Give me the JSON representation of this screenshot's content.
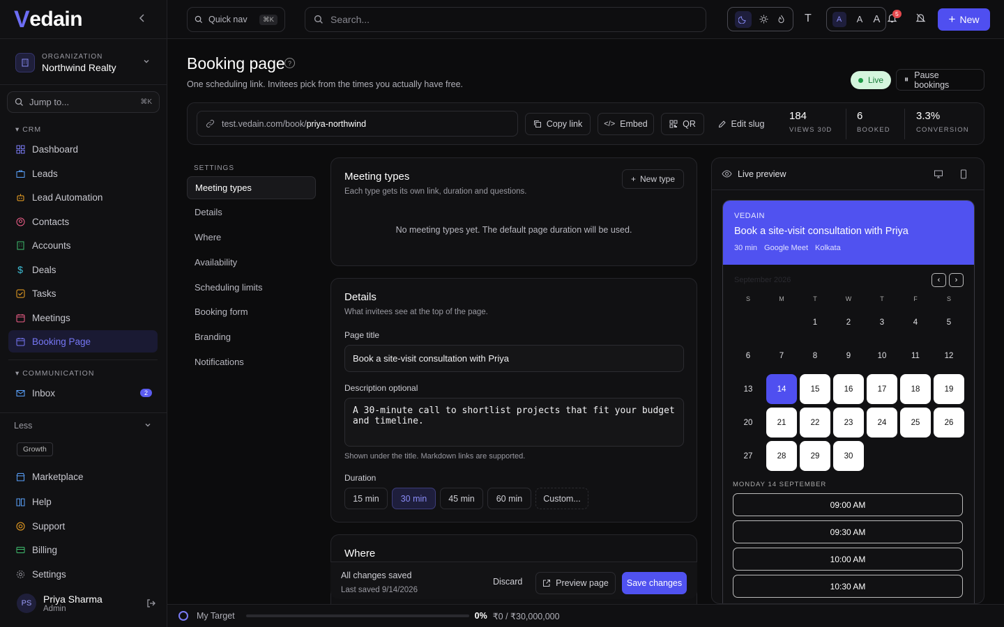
{
  "brand": {
    "logo_v": "V",
    "logo_rest": "edain"
  },
  "org": {
    "caption": "ORGANIZATION",
    "name": "Northwind Realty"
  },
  "jump": {
    "placeholder": "Jump to...",
    "shortcut": "⌘K"
  },
  "sidebar": {
    "crm_label": "CRM",
    "crm_items": [
      {
        "label": "Dashboard",
        "icon": "grid-icon"
      },
      {
        "label": "Leads",
        "icon": "briefcase-icon"
      },
      {
        "label": "Lead Automation",
        "icon": "robot-icon"
      },
      {
        "label": "Contacts",
        "icon": "contact-icon"
      },
      {
        "label": "Accounts",
        "icon": "building-icon"
      },
      {
        "label": "Deals",
        "icon": "dollar-icon"
      },
      {
        "label": "Tasks",
        "icon": "checkbox-icon"
      },
      {
        "label": "Meetings",
        "icon": "calendar-icon"
      },
      {
        "label": "Booking Page",
        "icon": "calendar-check-icon",
        "active": true
      }
    ],
    "comm_label": "COMMUNICATION",
    "inbox": {
      "label": "Inbox",
      "count": "2"
    },
    "less_label": "Less",
    "growth_tag": "Growth",
    "bottom_items": [
      {
        "label": "Marketplace",
        "icon": "store-icon"
      },
      {
        "label": "Help",
        "icon": "book-icon"
      },
      {
        "label": "Support",
        "icon": "lifebuoy-icon"
      },
      {
        "label": "Billing",
        "icon": "card-icon"
      },
      {
        "label": "Settings",
        "icon": "gear-icon"
      }
    ],
    "user": {
      "initials": "PS",
      "name": "Priya Sharma",
      "role": "Admin"
    }
  },
  "topbar": {
    "quicknav": "Quick nav",
    "quicknav_kbd": "⌘K",
    "search_placeholder": "Search...",
    "font_label": "T",
    "size_a": "A",
    "notif_count": "5",
    "new_label": "New"
  },
  "page": {
    "title": "Booking page",
    "subtitle": "One scheduling link. Invitees pick from the times you actually have free.",
    "live_label": "Live",
    "pause_label": "Pause bookings"
  },
  "link": {
    "url_prefix": "test.vedain.com/book/",
    "slug": "priya-northwind",
    "copy": "Copy link",
    "embed": "Embed",
    "qr": "QR",
    "edit_slug": "Edit slug"
  },
  "stats": [
    {
      "value": "184",
      "label": "VIEWS 30D"
    },
    {
      "value": "6",
      "label": "BOOKED"
    },
    {
      "value": "3.3%",
      "label": "CONVERSION"
    }
  ],
  "settings_nav": {
    "caption": "SETTINGS",
    "items": [
      "Meeting types",
      "Details",
      "Where",
      "Availability",
      "Scheduling limits",
      "Booking form",
      "Branding",
      "Notifications"
    ]
  },
  "meeting_types": {
    "title": "Meeting types",
    "subtitle": "Each type gets its own link, duration and questions.",
    "new_type": "New type",
    "empty": "No meeting types yet. The default page duration will be used."
  },
  "details": {
    "title": "Details",
    "subtitle": "What invitees see at the top of the page.",
    "page_title_label": "Page title",
    "page_title_value": "Book a site-visit consultation with Priya",
    "desc_label": "Description optional",
    "desc_value": "A 30-minute call to shortlist projects that fit your budget and timeline.",
    "desc_hint": "Shown under the title. Markdown links are supported.",
    "duration_label": "Duration",
    "durations": [
      "15 min",
      "30 min",
      "45 min",
      "60 min",
      "Custom..."
    ],
    "selected_duration": "30 min"
  },
  "where": {
    "title": "Where"
  },
  "savebar": {
    "status": "All changes saved",
    "last_saved": "Last saved 9/14/2026",
    "discard": "Discard",
    "preview": "Preview page",
    "save": "Save changes"
  },
  "preview": {
    "label": "Live preview",
    "org": "VEDAIN",
    "title": "Book a site-visit consultation with Priya",
    "meta": [
      "30 min",
      "Google Meet",
      "Kolkata"
    ],
    "month": "September 2026",
    "dow": [
      "S",
      "M",
      "T",
      "W",
      "T",
      "F",
      "S"
    ],
    "weeks": [
      [
        "",
        "",
        "1",
        "2",
        "3",
        "4",
        "5"
      ],
      [
        "6",
        "7",
        "8",
        "9",
        "10",
        "11",
        "12"
      ],
      [
        "13",
        "14",
        "15",
        "16",
        "17",
        "18",
        "19"
      ],
      [
        "20",
        "21",
        "22",
        "23",
        "24",
        "25",
        "26"
      ],
      [
        "27",
        "28",
        "29",
        "30",
        "",
        "",
        ""
      ]
    ],
    "available": [
      "14",
      "15",
      "16",
      "17",
      "18",
      "19",
      "21",
      "22",
      "23",
      "24",
      "25",
      "26",
      "28",
      "29",
      "30"
    ],
    "selected": "14",
    "date_label": "MONDAY 14 SEPTEMBER",
    "slots": [
      "09:00 AM",
      "09:30 AM",
      "10:00 AM",
      "10:30 AM"
    ]
  },
  "target": {
    "label": "My Target",
    "percent": "0%",
    "progress": 0,
    "amount": "₹0 / ₹30,000,000"
  }
}
